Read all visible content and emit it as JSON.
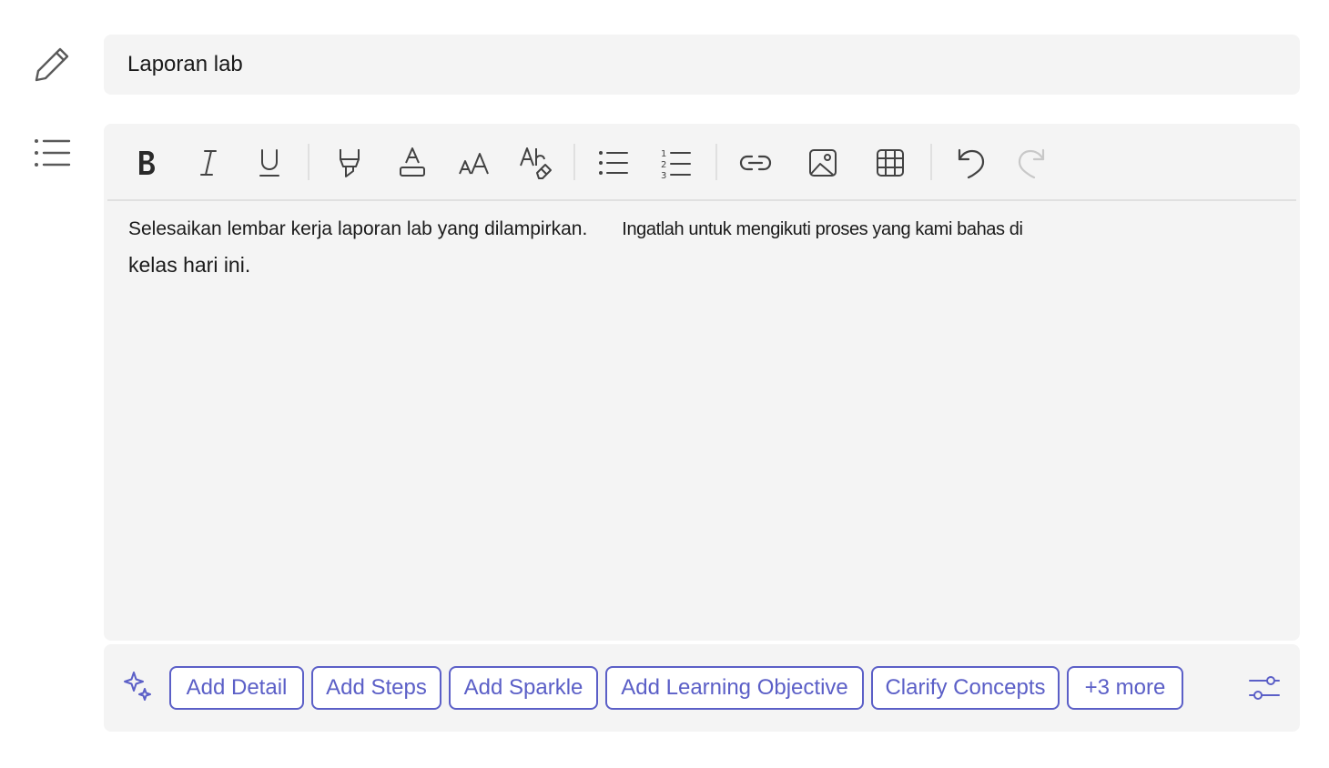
{
  "title_field": {
    "value": "Laporan lab"
  },
  "toolbar": {
    "buttons": [
      {
        "name": "bold",
        "icon": "bold-icon"
      },
      {
        "name": "italic",
        "icon": "italic-icon"
      },
      {
        "name": "underline",
        "icon": "underline-icon"
      },
      {
        "name": "highlight",
        "icon": "highlighter-icon"
      },
      {
        "name": "font-color",
        "icon": "font-color-icon"
      },
      {
        "name": "font-size",
        "icon": "font-size-icon"
      },
      {
        "name": "clear-formatting",
        "icon": "clear-formatting-icon"
      },
      {
        "name": "bulleted-list",
        "icon": "bulleted-list-icon"
      },
      {
        "name": "numbered-list",
        "icon": "numbered-list-icon"
      },
      {
        "name": "insert-link",
        "icon": "link-icon"
      },
      {
        "name": "insert-image",
        "icon": "image-icon"
      },
      {
        "name": "insert-table",
        "icon": "table-icon"
      },
      {
        "name": "undo",
        "icon": "undo-icon"
      },
      {
        "name": "redo",
        "icon": "redo-icon"
      }
    ]
  },
  "editor": {
    "line1_part1": "Selesaikan lembar kerja laporan lab yang dilampirkan.",
    "line1_part2": "Ingatlah untuk mengikuti proses yang kami bahas di",
    "line2": "kelas hari ini."
  },
  "ai_bar": {
    "chips": [
      "Add Detail",
      "Add Steps",
      "Add Sparkle",
      "Add Learning Objective",
      "Clarify Concepts",
      "+3 more"
    ]
  },
  "colors": {
    "accent": "#5b5fc7",
    "panel": "#f4f4f4",
    "icon": "#424242",
    "disabled_icon": "#c8c8c8"
  }
}
